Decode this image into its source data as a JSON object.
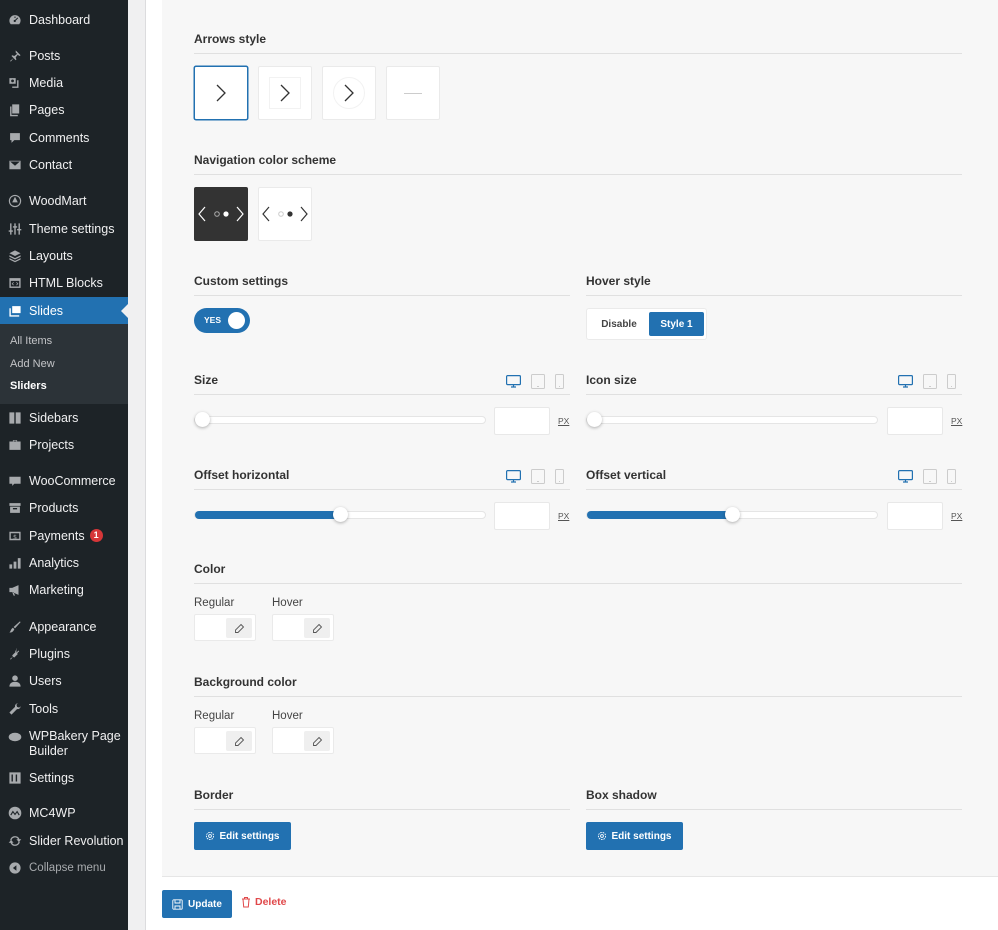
{
  "sidebar": {
    "items": [
      {
        "label": "Dashboard",
        "icon": "dashboard-icon"
      },
      {
        "label": "Posts",
        "icon": "pin-icon"
      },
      {
        "label": "Media",
        "icon": "media-icon"
      },
      {
        "label": "Pages",
        "icon": "pages-icon"
      },
      {
        "label": "Comments",
        "icon": "comment-icon"
      },
      {
        "label": "Contact",
        "icon": "envelope-icon"
      },
      {
        "label": "WoodMart",
        "icon": "woodmart-icon"
      },
      {
        "label": "Theme settings",
        "icon": "sliders-icon"
      },
      {
        "label": "Layouts",
        "icon": "layers-icon"
      },
      {
        "label": "HTML Blocks",
        "icon": "code-block-icon"
      },
      {
        "label": "Slides",
        "icon": "slides-icon",
        "active": true
      },
      {
        "label": "Sidebars",
        "icon": "sidebar-icon"
      },
      {
        "label": "Projects",
        "icon": "briefcase-icon"
      },
      {
        "label": "WooCommerce",
        "icon": "woo-icon"
      },
      {
        "label": "Products",
        "icon": "archive-icon"
      },
      {
        "label": "Payments",
        "icon": "dollar-icon",
        "badge": "1"
      },
      {
        "label": "Analytics",
        "icon": "bar-chart-icon"
      },
      {
        "label": "Marketing",
        "icon": "megaphone-icon"
      },
      {
        "label": "Appearance",
        "icon": "brush-icon"
      },
      {
        "label": "Plugins",
        "icon": "plug-icon"
      },
      {
        "label": "Users",
        "icon": "user-icon"
      },
      {
        "label": "Tools",
        "icon": "wrench-icon"
      },
      {
        "label": "WPBakery Page Builder",
        "line1": "WPBakery Page",
        "line2": "Builder",
        "icon": "cloud-icon"
      },
      {
        "label": "Settings",
        "icon": "settings-icon"
      },
      {
        "label": "MC4WP",
        "icon": "mc4wp-icon"
      },
      {
        "label": "Slider Revolution",
        "icon": "refresh-icon"
      },
      {
        "label": "Collapse menu",
        "icon": "collapse-icon"
      }
    ],
    "submenu": [
      {
        "label": "All Items"
      },
      {
        "label": "Add New"
      },
      {
        "label": "Sliders",
        "current": true
      }
    ]
  },
  "panel": {
    "arrows_style": {
      "title": "Arrows style",
      "options": [
        "arrow-plain",
        "arrow-square",
        "arrow-circle",
        "none"
      ],
      "selected": 0
    },
    "nav_color_scheme": {
      "title": "Navigation color scheme",
      "options": [
        "dark",
        "light"
      ],
      "selected": 0
    },
    "custom_settings": {
      "title": "Custom settings",
      "toggle_label": "YES",
      "value": true
    },
    "hover_style": {
      "title": "Hover style",
      "options": [
        "Disable",
        "Style 1"
      ],
      "selected": "Style 1"
    },
    "size": {
      "title": "Size",
      "value": "",
      "unit": "PX",
      "slider_percent": 0
    },
    "icon_size": {
      "title": "Icon size",
      "value": "",
      "unit": "PX",
      "slider_percent": 0
    },
    "offset_horizontal": {
      "title": "Offset horizontal",
      "value": "",
      "unit": "PX",
      "slider_percent": 50
    },
    "offset_vertical": {
      "title": "Offset vertical",
      "value": "",
      "unit": "PX",
      "slider_percent": 50
    },
    "color": {
      "title": "Color",
      "regular_label": "Regular",
      "hover_label": "Hover"
    },
    "background_color": {
      "title": "Background color",
      "regular_label": "Regular",
      "hover_label": "Hover"
    },
    "border": {
      "title": "Border",
      "button_label": "Edit settings"
    },
    "box_shadow": {
      "title": "Box shadow",
      "button_label": "Edit settings"
    }
  },
  "footer": {
    "update_label": "Update",
    "delete_label": "Delete"
  },
  "colors": {
    "accent": "#2271b1",
    "sidebar_bg": "#1d2327",
    "danger": "#e0484a",
    "badge": "#d63638"
  }
}
